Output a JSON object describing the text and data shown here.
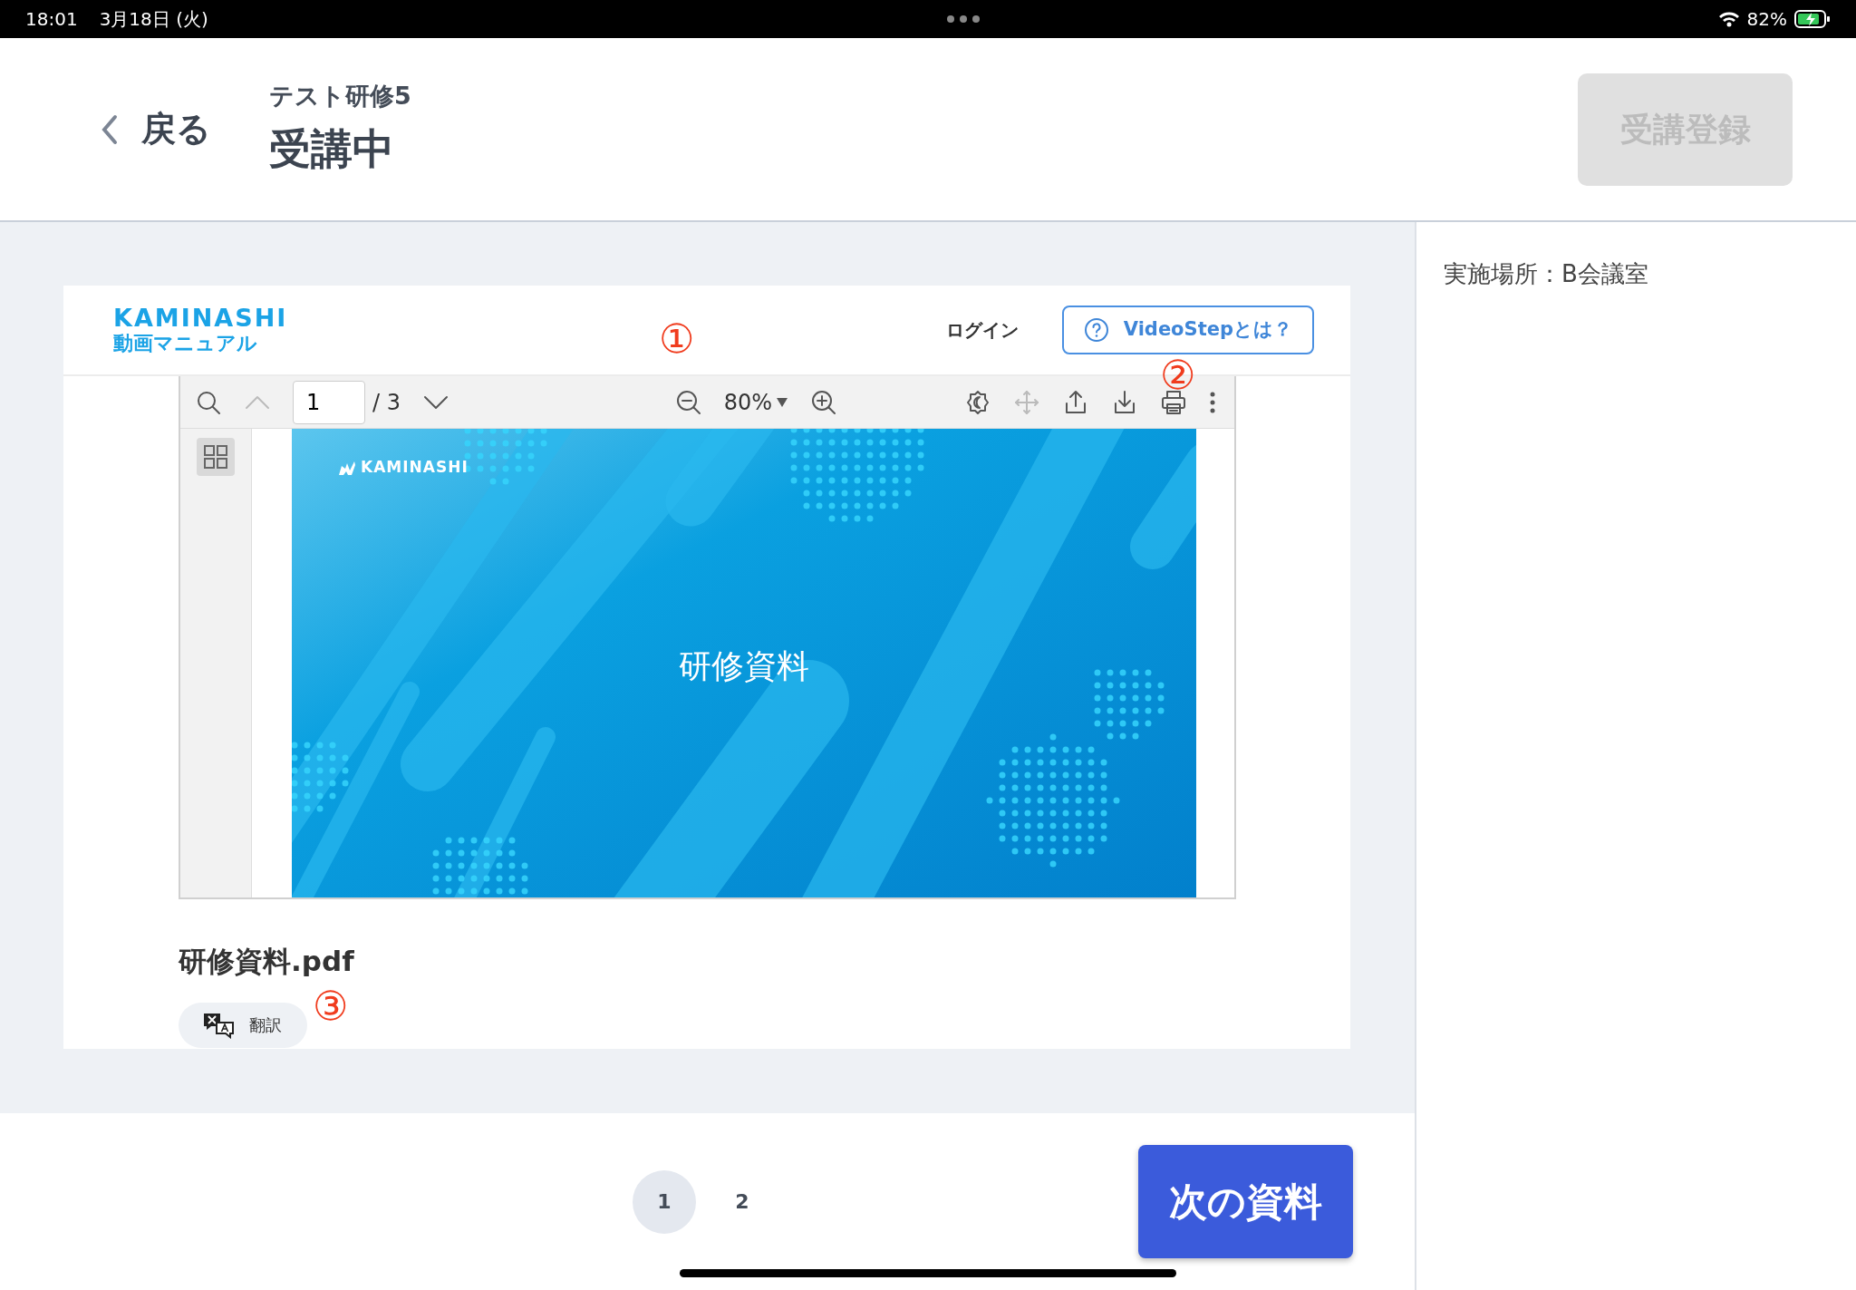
{
  "status_bar": {
    "time": "18:01",
    "date": "3月18日 (火)",
    "battery": "82%"
  },
  "header": {
    "back": "戻る",
    "subtitle": "テスト研修5",
    "title": "受講中",
    "register_button": {
      "label": "受講登録",
      "disabled": true
    }
  },
  "embed": {
    "logo": "KAMINASHI",
    "logo_sub": "動画マニュアル",
    "login": "ログイン",
    "about_button": "VideoStepとは？",
    "pdf_viewer": {
      "page": "1",
      "page_count": "/ 3",
      "zoom": "80%",
      "slide": {
        "logo": "KAMINASHI",
        "title": "研修資料"
      }
    },
    "file_name": "研修資料.pdf",
    "translate_button": "翻訳"
  },
  "annotations": [
    "①",
    "②",
    "③"
  ],
  "sidebar": {
    "location": "実施場所：B会議室"
  },
  "pagination": [
    {
      "label": "1",
      "selected": true
    },
    {
      "label": "2",
      "selected": false
    }
  ],
  "next_button": "次の資料"
}
